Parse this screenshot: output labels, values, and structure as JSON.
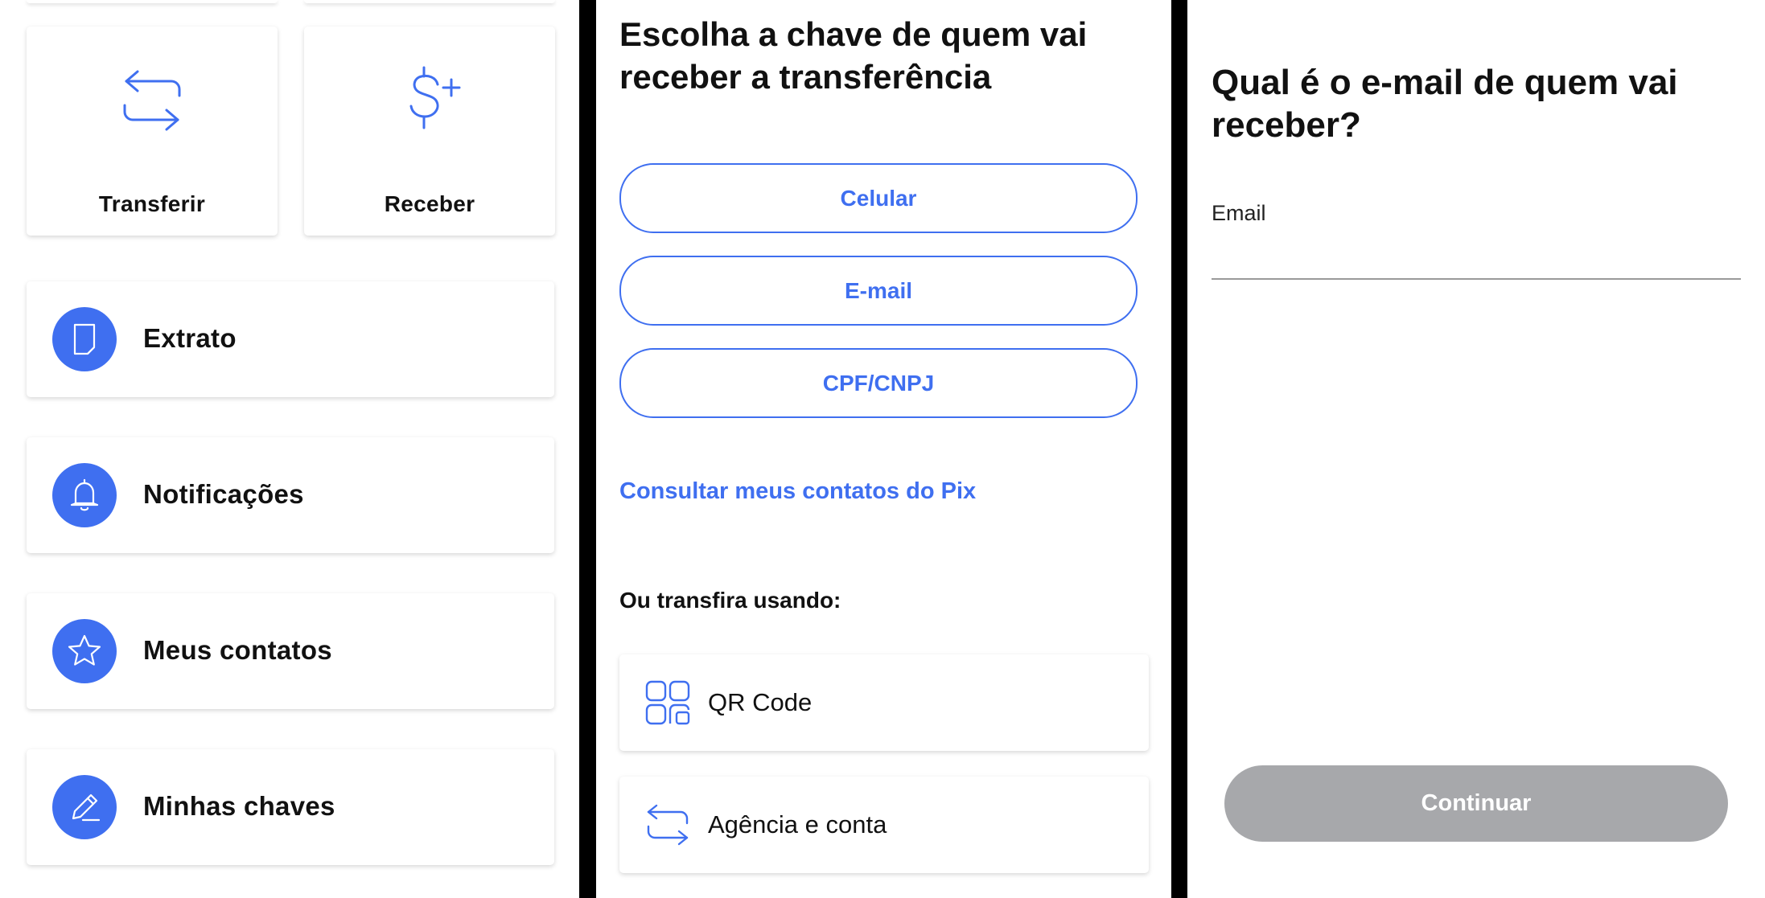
{
  "menu": {
    "tiles": [
      {
        "label": "Transferir",
        "icon": "transfer-arrows-icon"
      },
      {
        "label": "Receber",
        "icon": "dollar-plus-icon"
      }
    ],
    "items": [
      {
        "label": "Extrato",
        "icon": "statement-document-icon"
      },
      {
        "label": "Notificações",
        "icon": "bell-icon"
      },
      {
        "label": "Meus contatos",
        "icon": "star-icon"
      },
      {
        "label": "Minhas chaves",
        "icon": "pencil-icon"
      }
    ]
  },
  "key_selection": {
    "title": "Escolha a chave de quem vai receber a transferência",
    "options": [
      {
        "label": "Celular"
      },
      {
        "label": "E-mail"
      },
      {
        "label": "CPF/CNPJ"
      }
    ],
    "contacts_link": "Consultar meus contatos do Pix",
    "alternative_label": "Ou transfira usando:",
    "alternatives": [
      {
        "label": "QR Code",
        "icon": "qr-code-icon"
      },
      {
        "label": "Agência e conta",
        "icon": "transfer-arrows-icon"
      }
    ]
  },
  "email_step": {
    "title": "Qual é o e-mail de quem vai receber?",
    "field_label": "Email",
    "field_value": "",
    "continue_label": "Continuar"
  },
  "colors": {
    "accent": "#3f6ff0",
    "disabled_button": "#a7a8ab",
    "divider": "#000000"
  }
}
